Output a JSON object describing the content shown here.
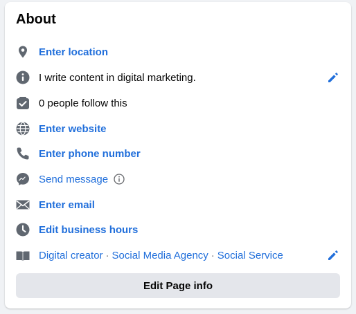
{
  "about": {
    "title": "About",
    "location_label": "Enter location",
    "bio": "I write content in digital marketing.",
    "followers": "0 people follow this",
    "website_label": "Enter website",
    "phone_label": "Enter phone number",
    "message_label": "Send message",
    "email_label": "Enter email",
    "hours_label": "Edit business hours",
    "categories": [
      "Digital creator",
      "Social Media Agency",
      "Social Service"
    ],
    "separator": "·",
    "edit_button": "Edit Page info"
  },
  "colors": {
    "link": "#216fdb",
    "icon": "#606770",
    "button_bg": "#e4e6eb"
  }
}
